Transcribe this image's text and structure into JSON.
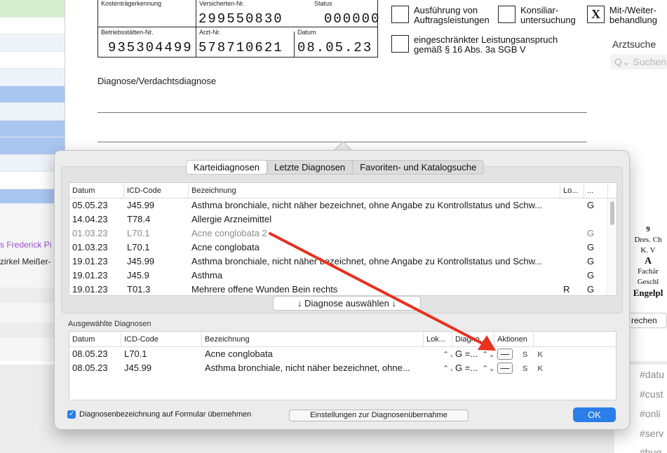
{
  "form": {
    "kostentraeger_label": "Kostenträgerkennung",
    "versicherten_label": "Versicherten-Nr.",
    "versicherten_value": "299550830",
    "status_label": "Status",
    "status_value": "000000",
    "betrieb_label": "Betriebsstätten-Nr.",
    "betrieb_value": "935304499",
    "arzt_label": "Arzt-Nr.",
    "arzt_value": "578710621",
    "datum_label": "Datum",
    "datum_value": "08.05.23",
    "chk_ausfuehrung": "Ausführung von\nAuftragsleistungen",
    "chk_konsiliar": "Konsiliar-\nuntersuchung",
    "chk_mitweiter": "Mit-/Weiter-\nbehandlung",
    "chk_mitweiter_mark": "X",
    "chk_eingeschraenkt": "eingeschränkter Leistungsanspruch\ngemäß § 16 Abs. 3a SGB V",
    "diagnose_label": "Diagnose/Verdachtsdiagnose",
    "arztsuche_label": "Arztsuche",
    "arztsuche_placeholder": "Q⌄ Suchen"
  },
  "background": {
    "link_text": "s Frederick Pi",
    "text2": "zirkel Meißer-",
    "right_doc": [
      "9",
      "Dres. Ch",
      "K. V",
      "A",
      "Fachär",
      "Geschl",
      "Engelpl"
    ],
    "rechnen": "rechen",
    "tags": [
      "#datu",
      "#cust",
      "#onli",
      "#serv",
      "#bug"
    ]
  },
  "popup": {
    "tabs": [
      "Karteidiagnosen",
      "Letzte Diagnosen",
      "Favoriten- und Katalogsuche"
    ],
    "active_tab": 0,
    "table1_headers": [
      "Datum",
      "ICD-Code",
      "Bezeichnung",
      "Lo...",
      "..."
    ],
    "table1_rows": [
      {
        "datum": "05.05.23",
        "icd": "J45.99",
        "bez": "Asthma bronchiale, nicht näher bezeichnet, ohne Angabe zu Kontrollstatus und Schw...",
        "lo": "",
        "x": "G",
        "grey": false
      },
      {
        "datum": "14.04.23",
        "icd": "T78.4",
        "bez": "Allergie Arzneimittel",
        "lo": "",
        "x": "",
        "grey": false
      },
      {
        "datum": "01.03.23",
        "icd": "L70.1",
        "bez": "Acne conglobata 2",
        "lo": "",
        "x": "G",
        "grey": true
      },
      {
        "datum": "01.03.23",
        "icd": "L70.1",
        "bez": "Acne conglobata",
        "lo": "",
        "x": "G",
        "grey": false
      },
      {
        "datum": "19.01.23",
        "icd": "J45.99",
        "bez": "Asthma bronchiale, nicht näher bezeichnet, ohne Angabe zu Kontrollstatus und Schw...",
        "lo": "",
        "x": "G",
        "grey": false
      },
      {
        "datum": "19.01.23",
        "icd": "J45.9",
        "bez": "Asthma",
        "lo": "",
        "x": "G",
        "grey": false
      },
      {
        "datum": "19.01.23",
        "icd": "T01.3",
        "bez": "Mehrere offene Wunden Bein rechts",
        "lo": "R",
        "x": "G",
        "grey": false
      }
    ],
    "select_button": "↓   Diagnose auswählen   ↓",
    "selected_title": "Ausgewählte Diagnosen",
    "table2_headers": [
      "Datum",
      "ICD-Code",
      "Bezeichnung",
      "Lok...",
      "Diagno...",
      "Aktionen"
    ],
    "table2_rows": [
      {
        "datum": "08.05.23",
        "icd": "L70.1",
        "bez": "Acne conglobata",
        "diag": "G =...",
        "minus": "—",
        "s": "S",
        "k": "K"
      },
      {
        "datum": "08.05.23",
        "icd": "J45.99",
        "bez": "Asthma bronchiale, nicht näher bezeichnet, ohne...",
        "diag": "G =...",
        "minus": "—",
        "s": "S",
        "k": "K"
      }
    ],
    "checkbox_label": "Diagnosenbezeichnung auf Formular übernehmen",
    "checkbox_checked": true,
    "settings_button": "Einstellungen zur Diagnosenübernahme",
    "ok_button": "OK"
  },
  "colors": {
    "accent": "#2b7de9",
    "annotation_arrow": "#e8301f",
    "row_blue": "#a9c6f1",
    "row_green": "#d6edce"
  }
}
